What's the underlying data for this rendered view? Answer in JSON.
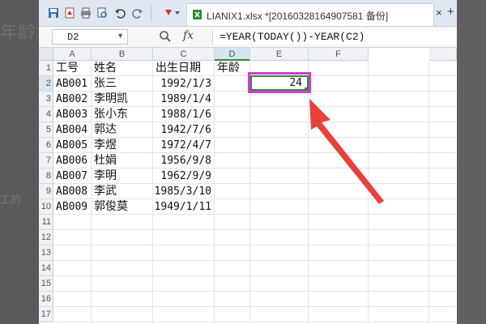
{
  "background": {
    "left_title": "年龄",
    "left_text": "工的"
  },
  "toolbar": {
    "icons": [
      "save-icon",
      "pdf-icon",
      "print-icon",
      "print-preview-icon",
      "undo-icon",
      "redo-icon",
      "paste-format-icon"
    ],
    "file_tab_label": "LIANIX1.xlsx *[20160328164907581 备份]",
    "close_label": "×",
    "add_label": "+"
  },
  "formula_bar": {
    "name_box": "D2",
    "fx_label": "fx",
    "formula": "=YEAR(TODAY())-YEAR(C2)"
  },
  "sheet": {
    "columns": [
      "A",
      "B",
      "C",
      "D",
      "E",
      "F"
    ],
    "rows": [
      "1",
      "2",
      "3",
      "4",
      "5",
      "6",
      "7",
      "8",
      "9",
      "10",
      "11",
      "12",
      "13",
      "14",
      "15",
      "16",
      "17"
    ],
    "headers": [
      "工号",
      "姓名",
      "出生日期",
      "年龄"
    ],
    "data": [
      [
        "AB001",
        "张三",
        "1992/1/3",
        "24"
      ],
      [
        "AB002",
        "李明凯",
        "1989/1/4",
        ""
      ],
      [
        "AB003",
        "张小东",
        "1988/1/6",
        ""
      ],
      [
        "AB004",
        "郭达",
        "1942/7/6",
        ""
      ],
      [
        "AB005",
        "李煜",
        "1972/4/7",
        ""
      ],
      [
        "AB006",
        "杜娟",
        "1956/9/8",
        ""
      ],
      [
        "AB007",
        "李明",
        "1962/9/9",
        ""
      ],
      [
        "AB008",
        "李武",
        "1985/3/10",
        ""
      ],
      [
        "AB009",
        "郭俊莫",
        "1949/1/11",
        ""
      ]
    ]
  },
  "colors": {
    "selection_green": "#2f8a3a",
    "annotation_magenta": "#d43bd6",
    "annotation_arrow": "#e8403a"
  }
}
